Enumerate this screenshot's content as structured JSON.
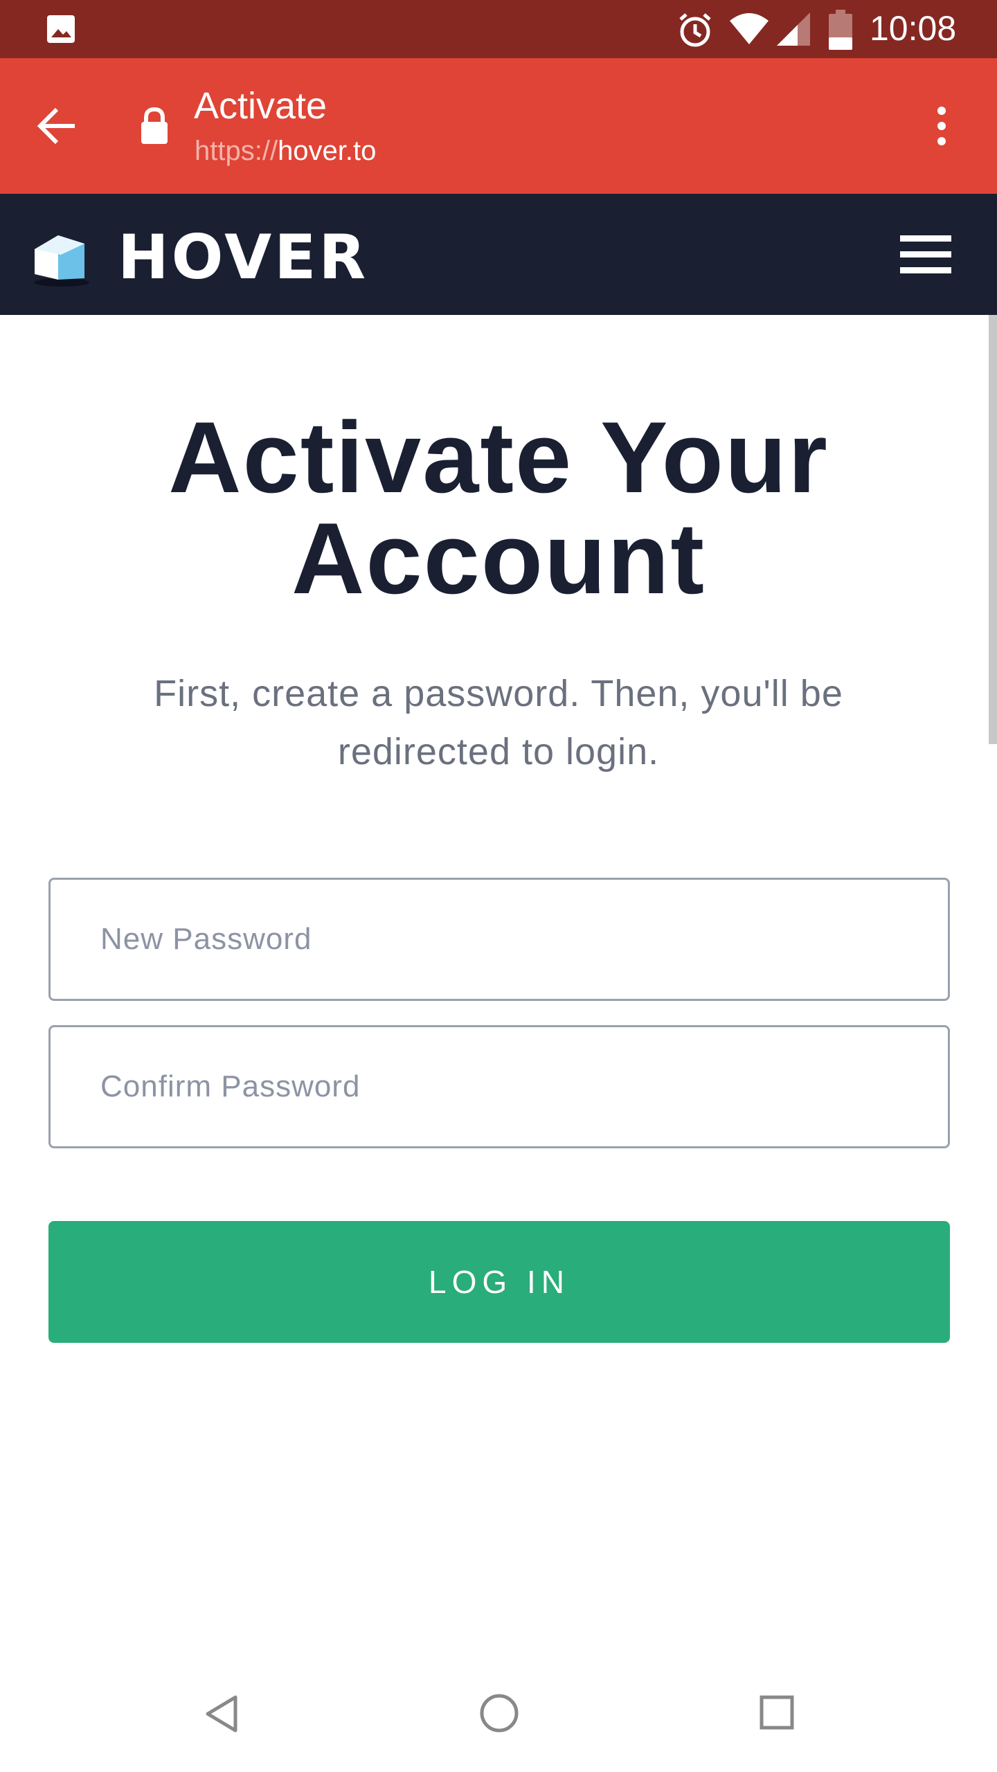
{
  "status_bar": {
    "time": "10:08",
    "icons": [
      "gallery-icon",
      "alarm-icon",
      "wifi-icon",
      "signal-icon",
      "battery-icon"
    ]
  },
  "browser": {
    "page_title": "Activate",
    "url_scheme": "https://",
    "url_host": "hover.to",
    "icons": [
      "back-arrow-icon",
      "lock-icon",
      "overflow-menu-icon"
    ],
    "toolbar_color": "#df4436"
  },
  "site_nav": {
    "logo_text": "HOVER",
    "icons": [
      "hover-logo-icon",
      "hamburger-menu-icon"
    ],
    "background_color": "#1a2032"
  },
  "main": {
    "heading_line1": "Activate Your",
    "heading_line2": "Account",
    "subtext": "First, create a password. Then, you'll be redirected to login.",
    "new_password_placeholder": "New Password",
    "confirm_password_placeholder": "Confirm Password",
    "login_label": "LOG IN",
    "button_color": "#29ad7a"
  },
  "system_nav": {
    "icons": [
      "back-triangle-icon",
      "home-circle-icon",
      "recents-square-icon"
    ]
  }
}
